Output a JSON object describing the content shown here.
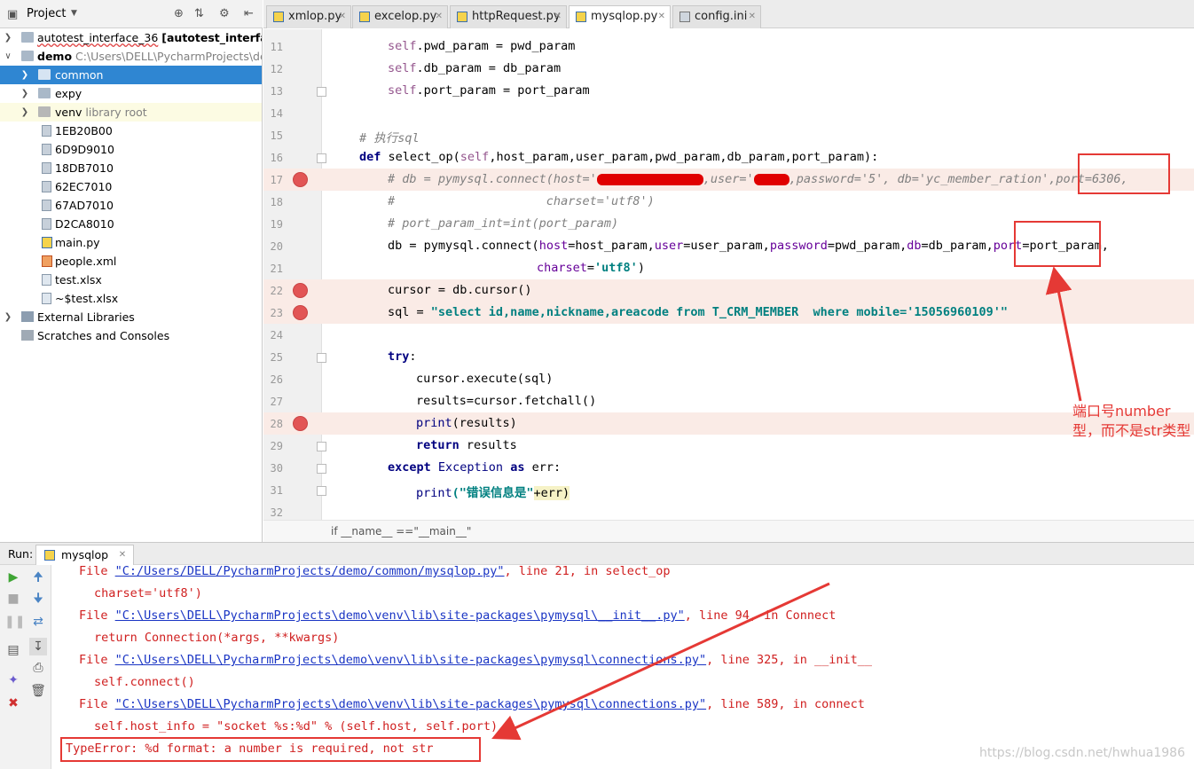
{
  "project_panel": {
    "title": "Project",
    "tree": [
      {
        "label": "autotest_interface_36",
        "suffix": "[autotest_interface]",
        "path": "",
        "selected": false
      },
      {
        "label": "demo",
        "suffix": "",
        "path": "C:\\Users\\DELL\\PycharmProjects\\dem",
        "selected": false
      },
      {
        "label": "common",
        "suffix": "",
        "path": "",
        "selected": true
      },
      {
        "label": "expy",
        "suffix": "",
        "path": "",
        "selected": false
      },
      {
        "label": "venv",
        "suffix": "",
        "path": "library root",
        "selected": false
      },
      {
        "label": "1EB20B00",
        "suffix": "",
        "path": "",
        "selected": false
      },
      {
        "label": "6D9D9010",
        "suffix": "",
        "path": "",
        "selected": false
      },
      {
        "label": "18DB7010",
        "suffix": "",
        "path": "",
        "selected": false
      },
      {
        "label": "62EC7010",
        "suffix": "",
        "path": "",
        "selected": false
      },
      {
        "label": "67AD7010",
        "suffix": "",
        "path": "",
        "selected": false
      },
      {
        "label": "D2CA8010",
        "suffix": "",
        "path": "",
        "selected": false
      },
      {
        "label": "main.py",
        "suffix": "",
        "path": "",
        "selected": false
      },
      {
        "label": "people.xml",
        "suffix": "",
        "path": "",
        "selected": false
      },
      {
        "label": "test.xlsx",
        "suffix": "",
        "path": "",
        "selected": false
      },
      {
        "label": "~$test.xlsx",
        "suffix": "",
        "path": "",
        "selected": false
      },
      {
        "label": "External Libraries",
        "suffix": "",
        "path": "",
        "selected": false
      },
      {
        "label": "Scratches and Consoles",
        "suffix": "",
        "path": "",
        "selected": false
      }
    ]
  },
  "tabs": [
    {
      "label": "xmlop.py",
      "active": false
    },
    {
      "label": "excelop.py",
      "active": false
    },
    {
      "label": "httpRequest.py",
      "active": false
    },
    {
      "label": "mysqlop.py",
      "active": true
    },
    {
      "label": "config.ini",
      "active": false
    }
  ],
  "editor": {
    "line_numbers": [
      "11",
      "12",
      "13",
      "14",
      "15",
      "16",
      "17",
      "18",
      "19",
      "20",
      "21",
      "22",
      "23",
      "24",
      "25",
      "26",
      "27",
      "28",
      "29",
      "30",
      "31",
      "32"
    ],
    "code": {
      "l11_self": "self",
      "l11_rest": ".pwd_param = pwd_param",
      "l12_self": "self",
      "l12_rest": ".db_param = db_param",
      "l13_self": "self",
      "l13_rest": ".port_param = port_param",
      "l15": "# 执行sql",
      "l16_kw": "def",
      "l16_name": " select_op(",
      "l16_self": "self",
      "l16_rest": ",host_param,user_param,pwd_param,db_param,port_param):",
      "l17_a": "# db = pymysql.connect(host='",
      "l17_b": ",user='",
      "l17_c": ",password='5",
      "l17_d": "', db='yc_member_ration',port=6306,",
      "l18": "#                     charset='utf8')",
      "l19": "# port_param_int=int(port_param)",
      "l20_a": "db = pymysql.connect(",
      "l20_h": "host",
      "l20_b": "=host_param,",
      "l20_u": "user",
      "l20_c": "=user_param,",
      "l20_p": "password",
      "l20_d": "=pwd_param,",
      "l20_db": "db",
      "l20_e": "=db_param,",
      "l20_port": "port",
      "l20_f": "=port_param,",
      "l21_k": "charset",
      "l21_eq": "=",
      "l21_s": "'utf8'",
      "l21_end": ")",
      "l22": "cursor = db.cursor()",
      "l23_a": "sql = ",
      "l23_s1": "\"select id,name,nickname,areacode from T_CRM_MEMBER  where mobile='15056960109'\"",
      "l25_kw": "try",
      "l25_end": ":",
      "l26": "cursor.execute(sql)",
      "l27": "results=cursor.fetchall()",
      "l28_f": "print",
      "l28_rest": "(results)",
      "l29_kw": "return",
      "l29_rest": " results",
      "l30_kw": "except",
      "l30_mid": " Exception ",
      "l30_kw2": "as",
      "l30_rest": " err:",
      "l31_f": "print",
      "l31_s": "(\"错误信息是\"",
      "l31_rest": "+err)"
    },
    "breadcrumb": "if __name__ ==\"__main__\""
  },
  "annotation": {
    "text": "端口号number型，而不是str类型",
    "color": "#e53935"
  },
  "run_panel": {
    "label": "Run:",
    "tab": "mysqlop",
    "console": [
      {
        "pre": "File ",
        "link": "\"C:/Users/DELL/PycharmProjects/demo/common/mysqlop.py\"",
        "post": ", line 21, in select_op"
      },
      {
        "text": "charset='utf8')"
      },
      {
        "pre": "File ",
        "link": "\"C:\\Users\\DELL\\PycharmProjects\\demo\\venv\\lib\\site-packages\\pymysql\\__init__.py\"",
        "post": ", line 94, in Connect"
      },
      {
        "text": "return Connection(*args, **kwargs)"
      },
      {
        "pre": "File ",
        "link": "\"C:\\Users\\DELL\\PycharmProjects\\demo\\venv\\lib\\site-packages\\pymysql\\connections.py\"",
        "post": ", line 325, in __init__"
      },
      {
        "text": "self.connect()"
      },
      {
        "pre": "File ",
        "link": "\"C:\\Users\\DELL\\PycharmProjects\\demo\\venv\\lib\\site-packages\\pymysql\\connections.py\"",
        "post": ", line 589, in connect"
      },
      {
        "text": "self.host_info = \"socket %s:%d\" % (self.host, self.port)"
      },
      {
        "text": "TypeError: %d format: a number is required, not str"
      }
    ]
  },
  "watermark": "https://blog.csdn.net/hwhua1986"
}
